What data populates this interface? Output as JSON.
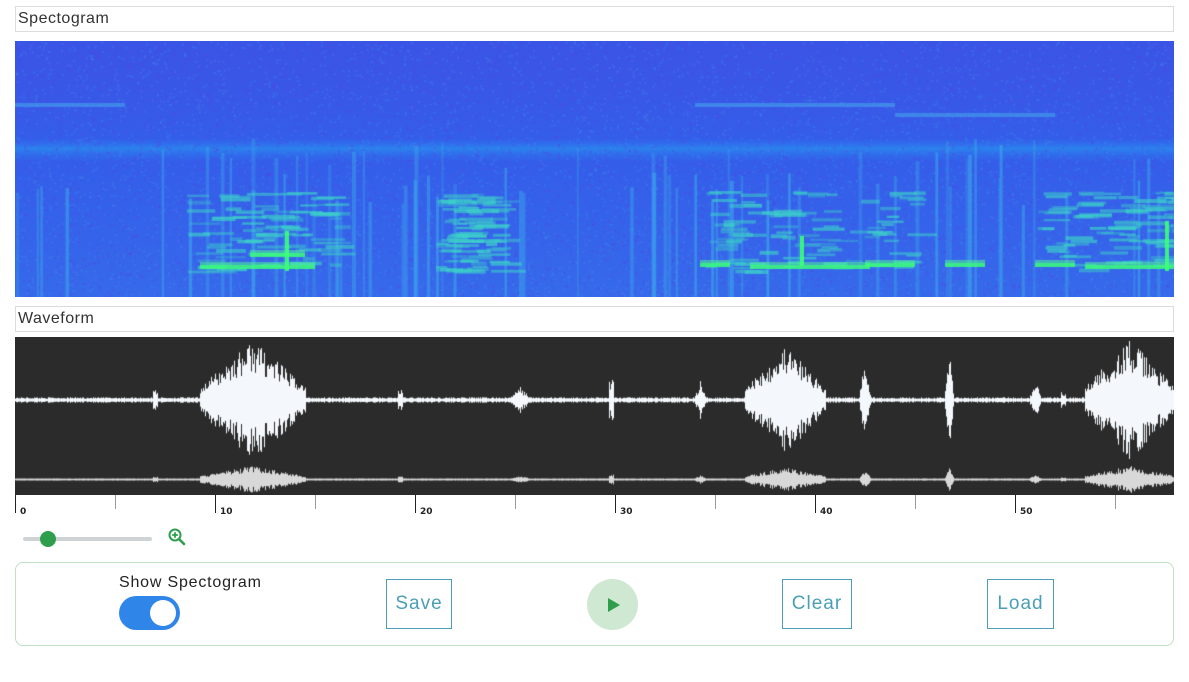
{
  "sections": {
    "spectrogram_label": "Spectogram",
    "waveform_label": "Waveform"
  },
  "timeline": {
    "tick_labels": [
      "0",
      "10",
      "20",
      "30",
      "40",
      "50"
    ],
    "minor_step": 5,
    "major_step": 10,
    "max_seconds": 58
  },
  "zoom": {
    "level": 0.15,
    "icon": "zoom-in-icon"
  },
  "controls": {
    "toggle_label": "Show Spectogram",
    "toggle_on": true,
    "save_label": "Save",
    "play_icon": "play-icon",
    "clear_label": "Clear",
    "load_label": "Load"
  },
  "colors": {
    "accent_green": "#2e9e4d",
    "toggle_blue": "#2f86e8",
    "button_teal": "#4a9fb5",
    "waveform_bg": "#2b2b2b",
    "spectrogram_base": "#3a55e6"
  }
}
